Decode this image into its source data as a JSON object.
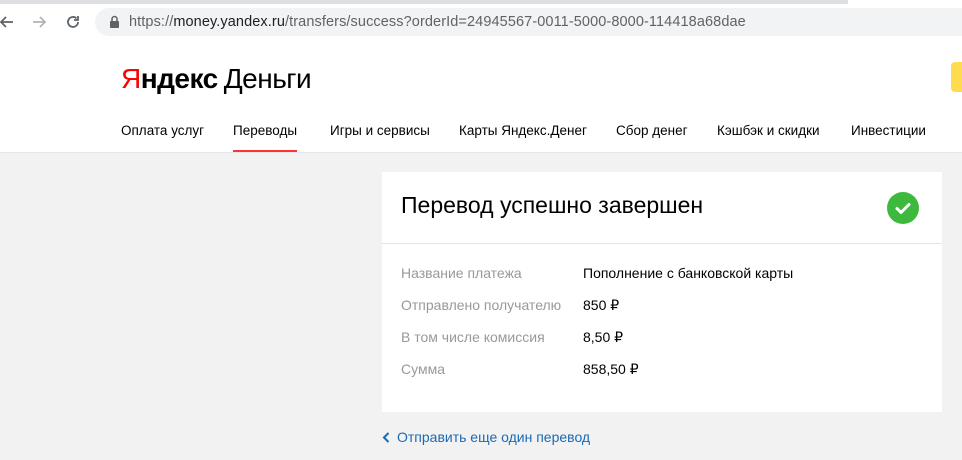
{
  "browser": {
    "url_scheme": "https://",
    "url_host": "money.yandex.ru",
    "url_path": "/transfers/success?orderId=24945567-0011-5000-8000-114418a68dae"
  },
  "header": {
    "logo_part1": "Я",
    "logo_part2": "ндекс",
    "logo_part3": "Деньги",
    "nav": [
      {
        "label": "Оплата услуг"
      },
      {
        "label": "Переводы",
        "active": true
      },
      {
        "label": "Игры и сервисы"
      },
      {
        "label": "Карты Яндекс.Денег"
      },
      {
        "label": "Сбор денег"
      },
      {
        "label": "Кэшбэк и скидки"
      },
      {
        "label": "Инвестиции"
      }
    ]
  },
  "result": {
    "title": "Перевод успешно завершен",
    "status_icon": "check-circle-icon",
    "status_color": "#3db93d",
    "details": [
      {
        "label": "Название платежа",
        "value": "Пополнение с банковской карты"
      },
      {
        "label": "Отправлено получателю",
        "value": "850 ₽"
      },
      {
        "label": "В том числе комиссия",
        "value": "8,50 ₽"
      },
      {
        "label": "Сумма",
        "value": "858,50 ₽"
      }
    ]
  },
  "actions": {
    "send_another": "Отправить еще один перевод"
  },
  "colors": {
    "brand_red": "#ff0000",
    "link": "#1a6ab5",
    "accent_yellow": "#ffdb4d"
  }
}
